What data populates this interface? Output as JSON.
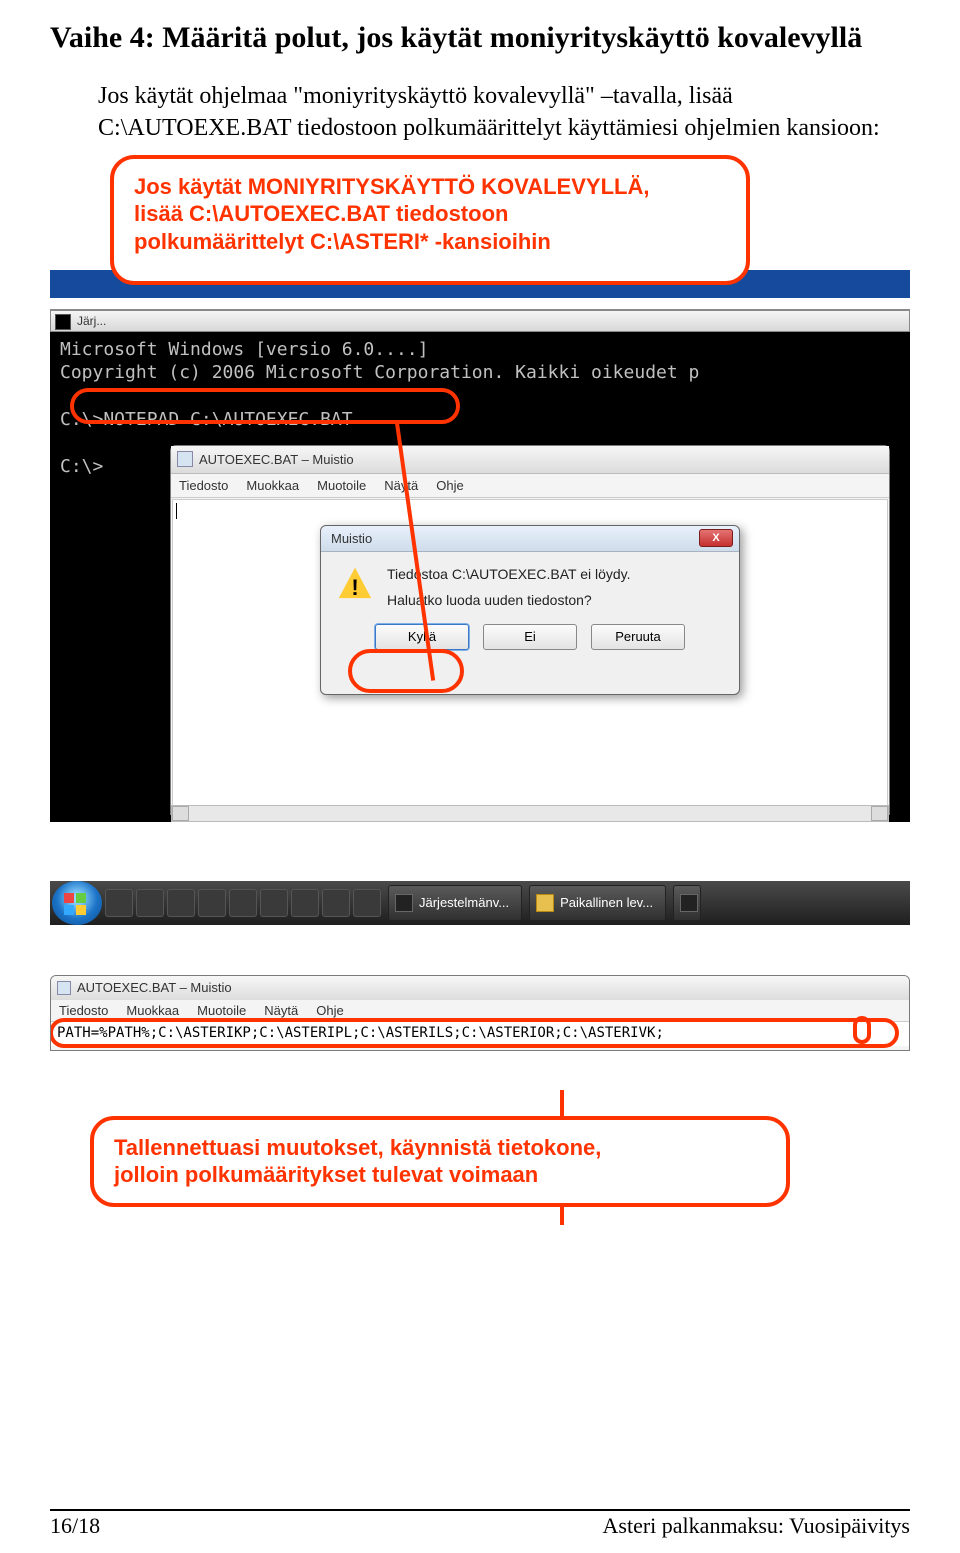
{
  "heading": "Vaihe 4: Määritä polut, jos käytät moniyrityskäyttö kovalevyllä",
  "intro": "Jos käytät ohjelmaa \"moniyrityskäyttö kovalevyllä\" –tavalla, lisää C:\\AUTOEXE.BAT tiedostoon polkumäärittelyt käyttämiesi ohjelmien kansioon:",
  "callout_top_line1": "Jos käytät MONIYRITYSKÄYTTÖ KOVALEVYLLÄ,",
  "callout_top_line2": "lisää C:\\AUTOEXEC.BAT tiedostoon",
  "callout_top_line3": "polkumäärittelyt C:\\ASTERI* -kansioihin",
  "cmd_title": "Järj...",
  "cmd_line1": "Microsoft Windows [versio 6.0....]",
  "cmd_line2": "Copyright (c) 2006 Microsoft Corporation. Kaikki oikeudet p",
  "cmd_line3": "C:\\>NOTEPAD C:\\AUTOEXEC.BAT",
  "cmd_line4": "C:\\>",
  "notepad_title": "AUTOEXEC.BAT – Muistio",
  "menu": {
    "tiedosto": "Tiedosto",
    "muokkaa": "Muokkaa",
    "muotoile": "Muotoile",
    "nayta": "Näytä",
    "ohje": "Ohje"
  },
  "dialog": {
    "title": "Muistio",
    "line1": "Tiedostoa C:\\AUTOEXEC.BAT ei löydy.",
    "line2": "Haluatko luoda uuden tiedoston?",
    "yes": "Kyllä",
    "no": "Ei",
    "cancel": "Peruuta",
    "close": "X"
  },
  "taskbar": {
    "item1": "Järjestelmänv...",
    "item2": "Paikallinen lev..."
  },
  "notepad2_content": "PATH=%PATH%;C:\\ASTERIKP;C:\\ASTERIPL;C:\\ASTERILS;C:\\ASTERIOR;C:\\ASTERIVK;",
  "callout_bottom_line1": "Tallennettuasi muutokset, käynnistä tietokone,",
  "callout_bottom_line2": "jolloin polkumääritykset tulevat voimaan",
  "footer_left": "16/18",
  "footer_right": "Asteri palkanmaksu: Vuosipäivitys"
}
